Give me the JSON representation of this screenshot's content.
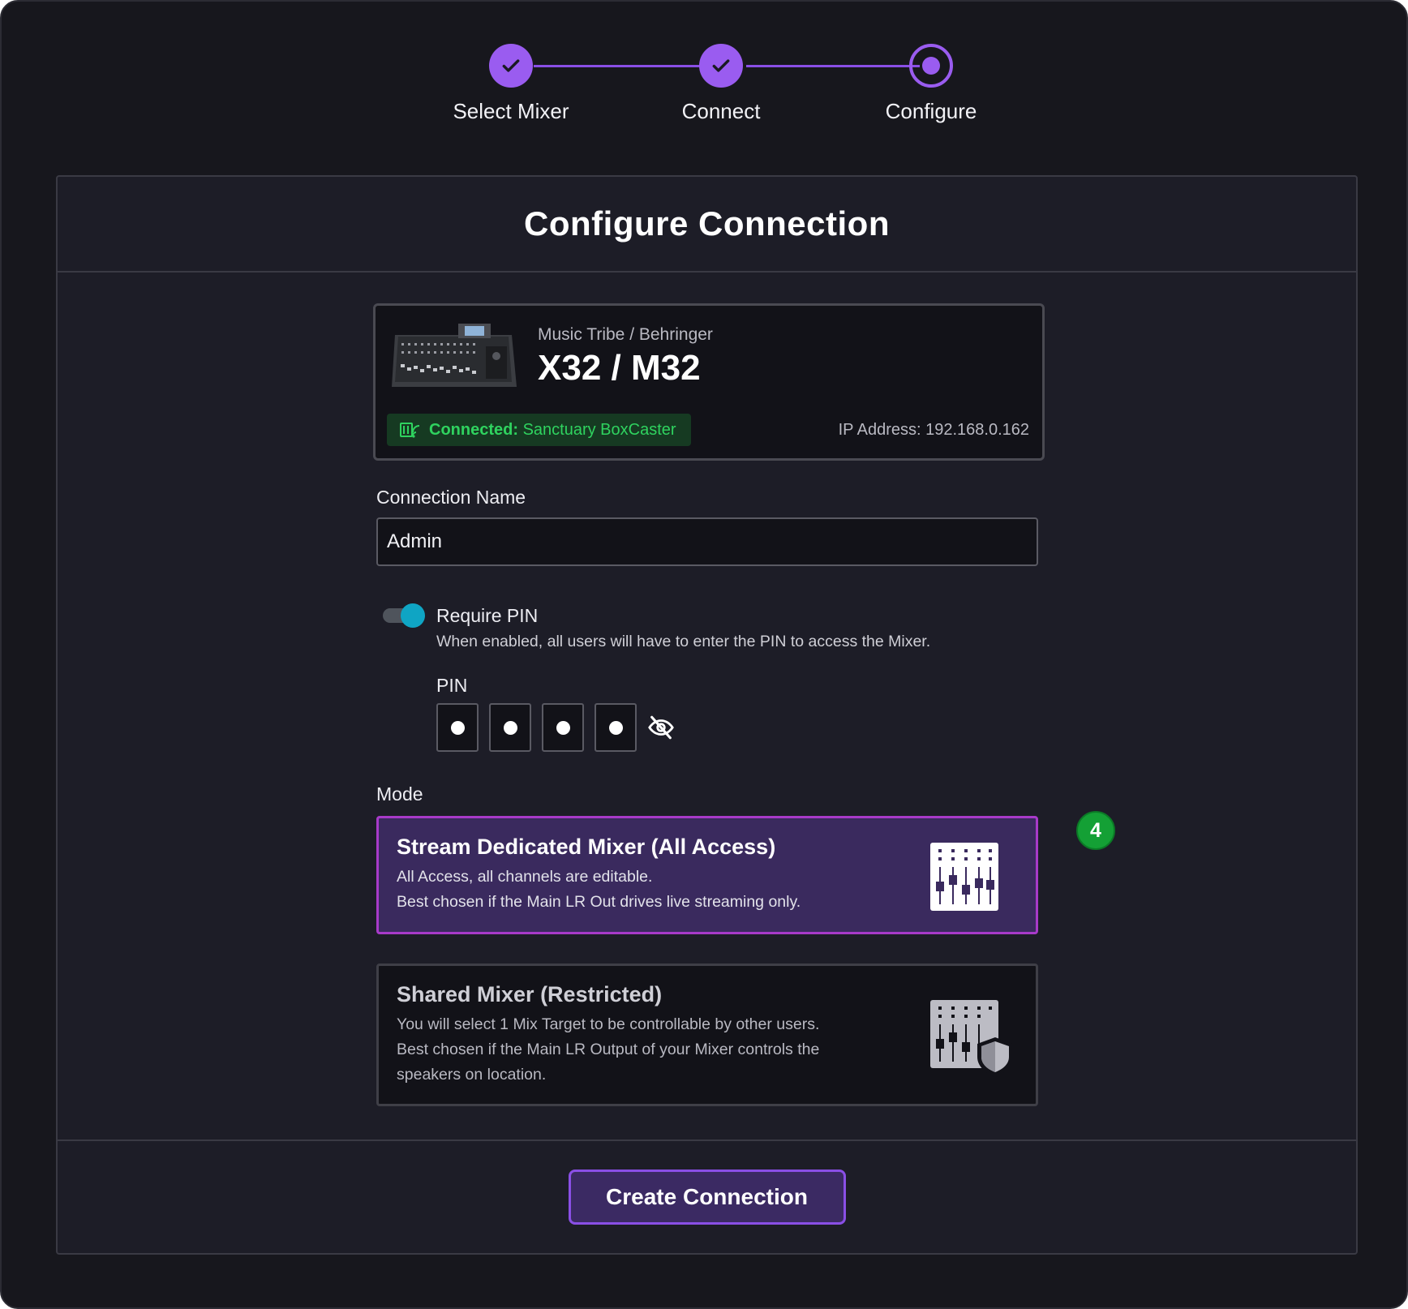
{
  "stepper": {
    "steps": [
      {
        "label": "Select Mixer",
        "state": "done"
      },
      {
        "label": "Connect",
        "state": "done"
      },
      {
        "label": "Configure",
        "state": "current"
      }
    ]
  },
  "card": {
    "title": "Configure Connection",
    "create_button": "Create Connection"
  },
  "mixer": {
    "brand": "Music Tribe / Behringer",
    "model": "X32 / M32",
    "status_prefix": "Connected:",
    "status_name": "Sanctuary BoxCaster",
    "ip": "IP Address: 192.168.0.162"
  },
  "connection_name": {
    "label": "Connection Name",
    "value": "Admin"
  },
  "pin": {
    "toggle_on": true,
    "title": "Require PIN",
    "description": "When enabled, all users will have to enter the PIN to access the Mixer.",
    "label": "PIN",
    "digits_filled": 4
  },
  "mode": {
    "label": "Mode",
    "options": [
      {
        "title": "Stream Dedicated Mixer (All Access)",
        "line1": "All Access, all channels are editable.",
        "line2": "Best chosen if the Main LR Out drives live streaming only.",
        "selected": true,
        "icon": "mixer-faders-icon"
      },
      {
        "title": "Shared Mixer (Restricted)",
        "line1": "You will select 1 Mix Target to be controllable by other users.",
        "line2": "Best chosen if the Main LR Output of your Mixer controls the speakers on location.",
        "selected": false,
        "icon": "mixer-shield-icon"
      }
    ]
  },
  "annotation_badge": "4",
  "colors": {
    "accent": "#9a5cf0",
    "connected": "#2fd35f",
    "toggle": "#0fa5c4",
    "badge": "#14a035"
  }
}
